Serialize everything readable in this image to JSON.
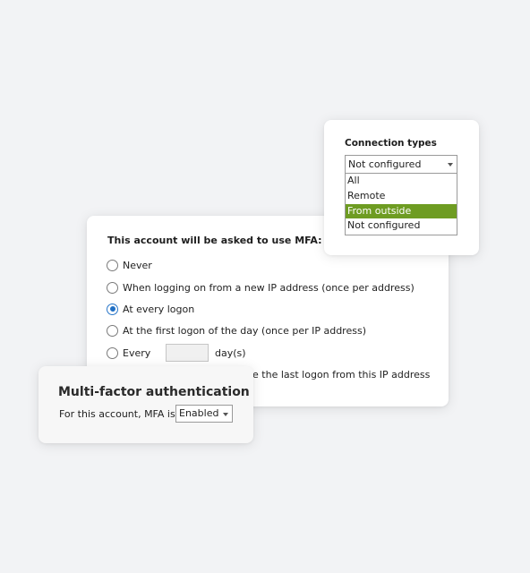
{
  "mfa_options": {
    "heading": "This account will be asked to use MFA:",
    "options": [
      {
        "label": "Never",
        "checked": false
      },
      {
        "label": "When logging on from a new IP address (once per address)",
        "checked": false
      },
      {
        "label": "At every logon",
        "checked": true
      },
      {
        "label": "At the first logon of the day (once per IP address)",
        "checked": false
      },
      {
        "label": "Every",
        "checked": false
      }
    ],
    "days_value": "",
    "days_suffix": "day(s)",
    "last_logon_partial": "nce the last logon from this IP address"
  },
  "connection_types": {
    "heading": "Connection types",
    "selected_value": "Not configured",
    "options": [
      {
        "label": "All",
        "highlighted": false
      },
      {
        "label": "Remote",
        "highlighted": false
      },
      {
        "label": "From outside",
        "highlighted": true
      },
      {
        "label": "Not configured",
        "highlighted": false
      }
    ],
    "highlight_color": "#6e9c22"
  },
  "mfa_summary": {
    "title": "Multi-factor authentication",
    "label": "For this account, MFA is",
    "selected_value": "Enabled"
  },
  "icons": [
    "chevron-down-icon",
    "radio-icon"
  ]
}
